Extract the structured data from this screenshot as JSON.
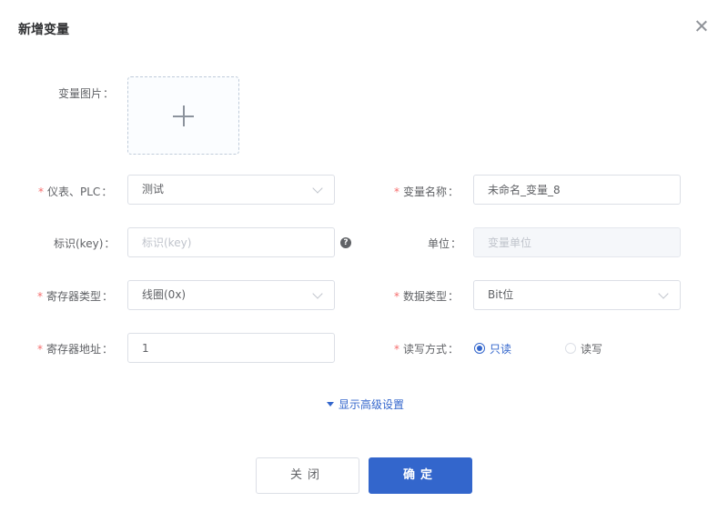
{
  "dialog": {
    "title": "新增变量"
  },
  "form": {
    "image_label": "变量图片",
    "instrument": {
      "label": "仪表、PLC",
      "value": "测试",
      "required": true
    },
    "var_name": {
      "label": "变量名称",
      "value": "未命名_变量_8",
      "required": true
    },
    "key": {
      "label": "标识(key)",
      "placeholder": "标识(key)",
      "value": ""
    },
    "unit": {
      "label": "单位",
      "placeholder": "变量单位",
      "value": ""
    },
    "register_type": {
      "label": "寄存器类型",
      "value": "线圈(0x)",
      "required": true
    },
    "data_type": {
      "label": "数据类型",
      "value": "Bit位",
      "required": true
    },
    "register_addr": {
      "label": "寄存器地址",
      "value": "1",
      "required": true
    },
    "rw_mode": {
      "label": "读写方式",
      "required": true,
      "options": [
        "只读",
        "读写"
      ],
      "selected": "只读"
    },
    "advanced_toggle": "显示高级设置"
  },
  "buttons": {
    "cancel": "关闭",
    "ok": "确定"
  },
  "colors": {
    "primary": "#3366cc",
    "required": "#f56c6c",
    "border": "#dcdfe6"
  }
}
